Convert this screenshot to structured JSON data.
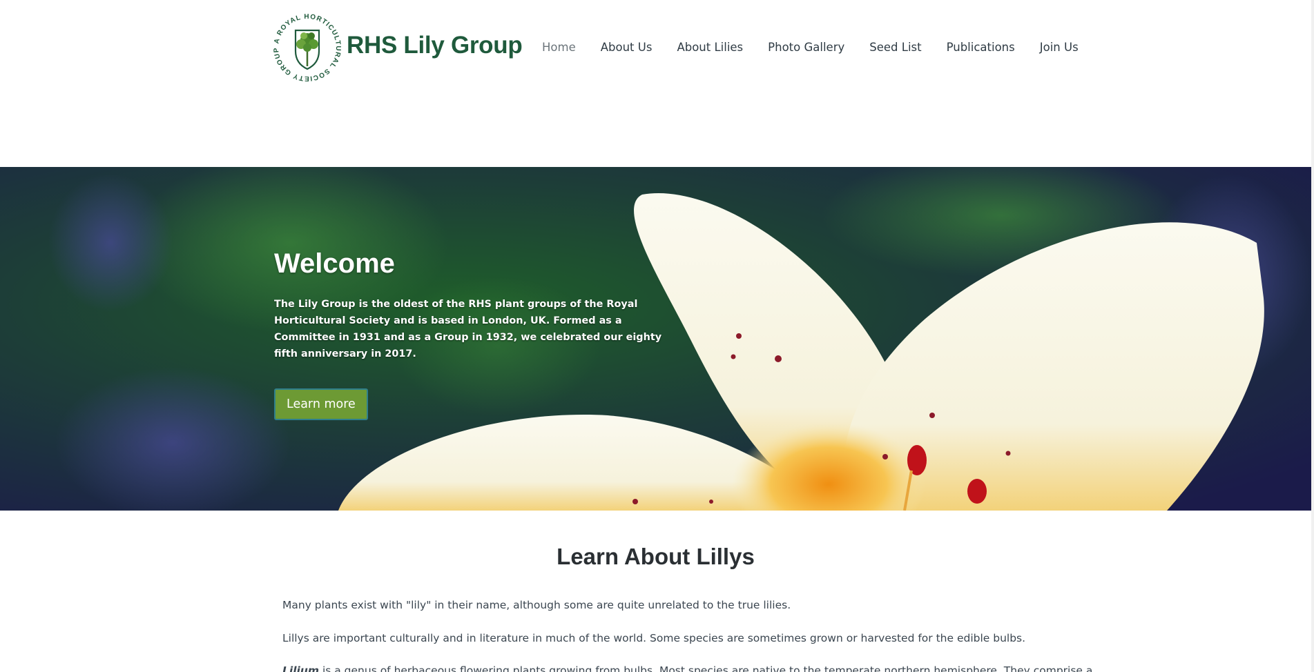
{
  "header": {
    "brand": "RHS Lily Group",
    "logo_ring_text": "A ROYAL HORTICULTURAL SOCIETY GROUP"
  },
  "nav": {
    "items": [
      {
        "label": "Home",
        "active": true
      },
      {
        "label": "About Us"
      },
      {
        "label": "About Lilies"
      },
      {
        "label": "Photo Gallery"
      },
      {
        "label": "Seed List"
      },
      {
        "label": "Publications"
      },
      {
        "label": "Join Us"
      }
    ]
  },
  "hero": {
    "title": "Welcome",
    "text": "The Lily Group is the oldest of the RHS plant groups of the Royal Horticultural Society and is based in London, UK. Formed as a Committee in 1931 and as a Group in 1932, we celebrated our eighty fifth anniversary in 2017.",
    "button_label": "Learn more"
  },
  "main": {
    "section_title": "Learn About Lillys",
    "paragraphs": [
      "Many plants exist with \"lily\" in their name, although some are quite unrelated to the true lilies.",
      "Lillys are important culturally and in literature in much of the world. Some species are sometimes grown or harvested for the edible bulbs."
    ],
    "p3_emphasis": "Lilium",
    "p3_rest": " is a genus of herbaceous flowering plants growing from bulbs. Most species are native to the temperate northern hemisphere. They comprise a"
  },
  "colors": {
    "brand_green": "#1f5a3c",
    "button_green": "#6d9a34",
    "button_border": "#2f7f8c",
    "nav_text": "#2f3b44"
  },
  "icons": {
    "logo": "tree-shield-logo"
  }
}
